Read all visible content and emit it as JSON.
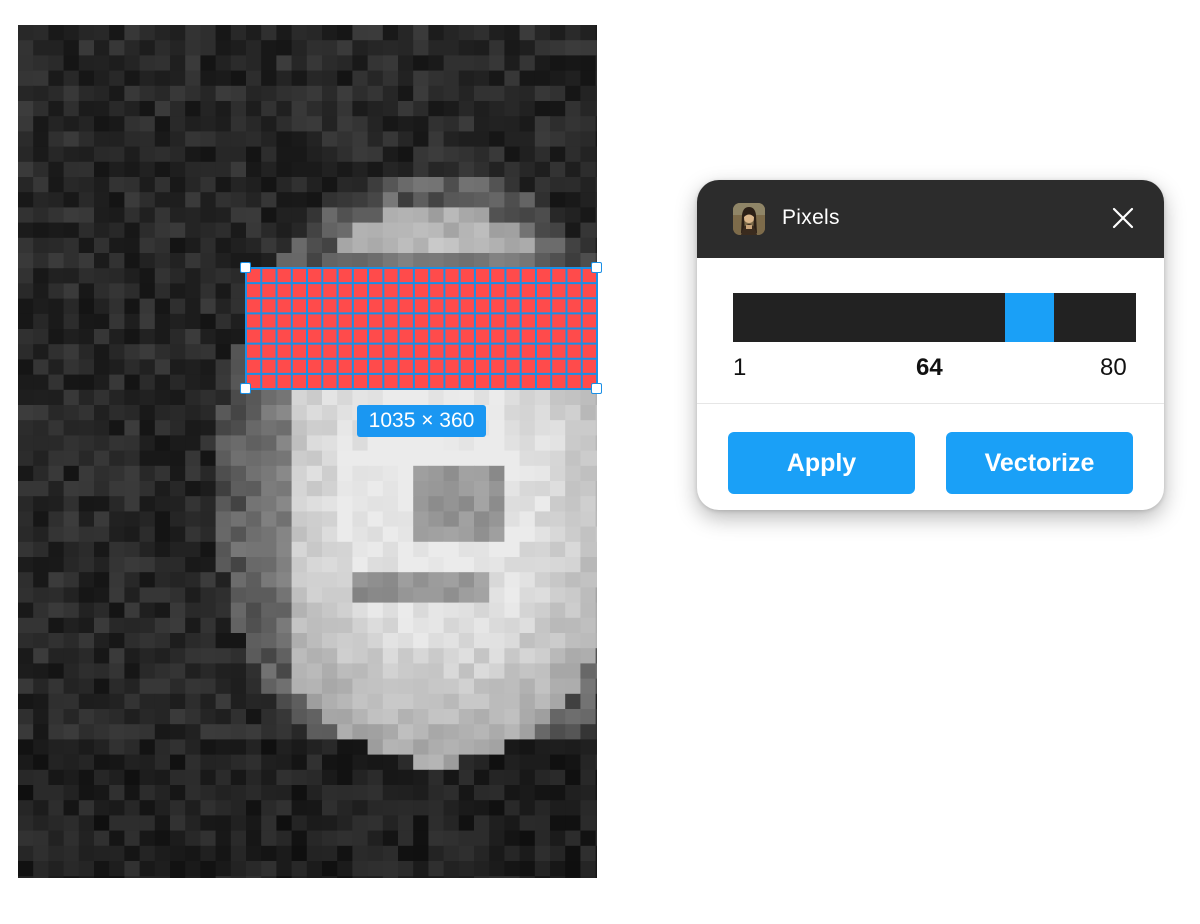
{
  "canvas": {
    "selection_dimensions": "1035 × 360"
  },
  "plugin": {
    "title": "Pixels",
    "icon": "mona-lisa-thumbnail-icon",
    "close_icon": "close-icon"
  },
  "slider": {
    "min_label": "1",
    "value_label": "64",
    "max_label": "80",
    "min": 1,
    "max": 80,
    "value": 64
  },
  "actions": {
    "apply_label": "Apply",
    "vectorize_label": "Vectorize"
  },
  "colors": {
    "accent": "#1aa0f7",
    "selection_fill": "#ff4b4b",
    "header_bg": "#2c2c2c",
    "track_bg": "#222222"
  }
}
